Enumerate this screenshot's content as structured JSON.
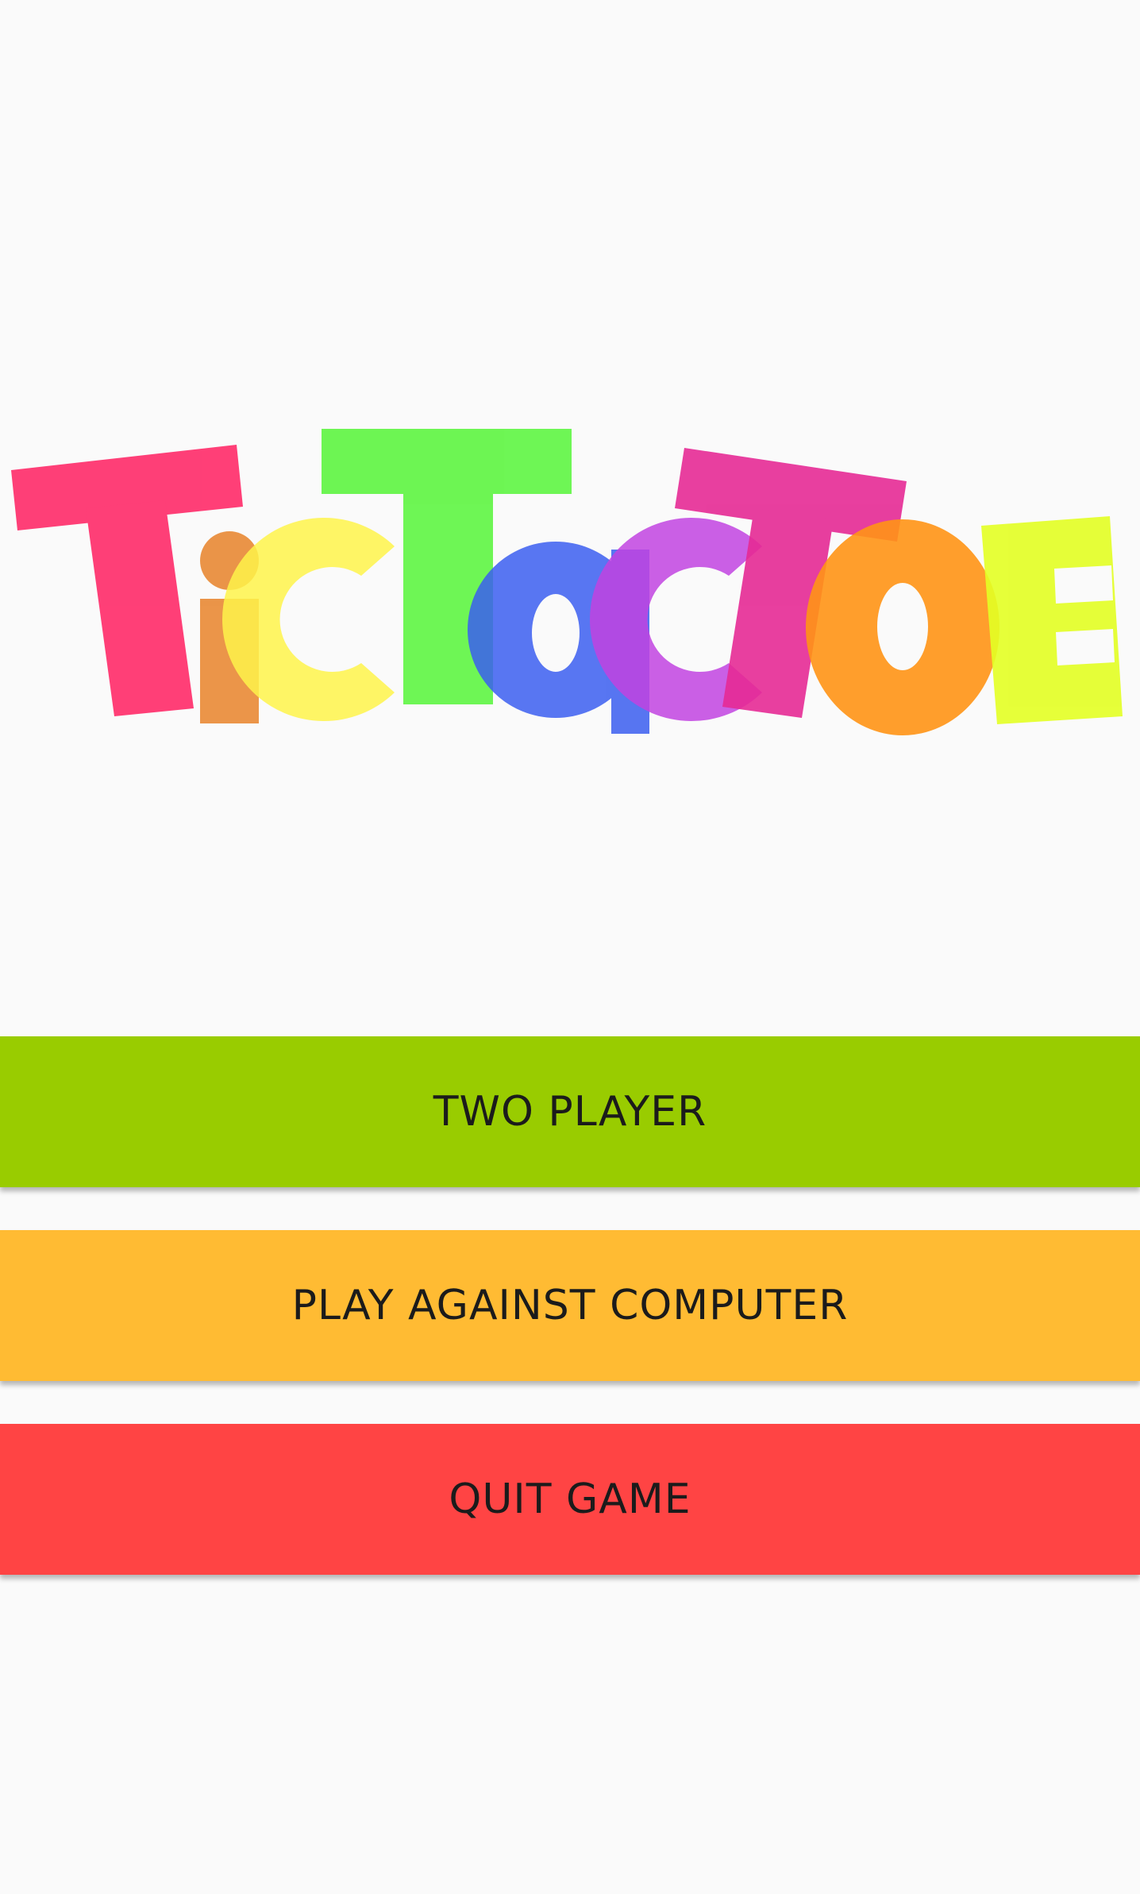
{
  "logo": {
    "alt": "Tic Tac Toe",
    "letters": [
      {
        "char": "T",
        "color": "#ff3570"
      },
      {
        "char": "i",
        "color": "#e98a35"
      },
      {
        "char": "c",
        "color": "#fef34a"
      },
      {
        "char": "T",
        "color": "#5ef542"
      },
      {
        "char": "a",
        "color": "#3b5ef0"
      },
      {
        "char": "c",
        "color": "#c143e0"
      },
      {
        "char": "T",
        "color": "#e62a95"
      },
      {
        "char": "o",
        "color": "#ff9315"
      },
      {
        "char": "E",
        "color": "#e3ff24"
      }
    ]
  },
  "buttons": {
    "two_player": {
      "label": "TWO PLAYER",
      "color": "#99cc00"
    },
    "vs_computer": {
      "label": "PLAY AGAINST COMPUTER",
      "color": "#ffbb33"
    },
    "quit": {
      "label": "QUIT GAME",
      "color": "#ff4444"
    }
  }
}
